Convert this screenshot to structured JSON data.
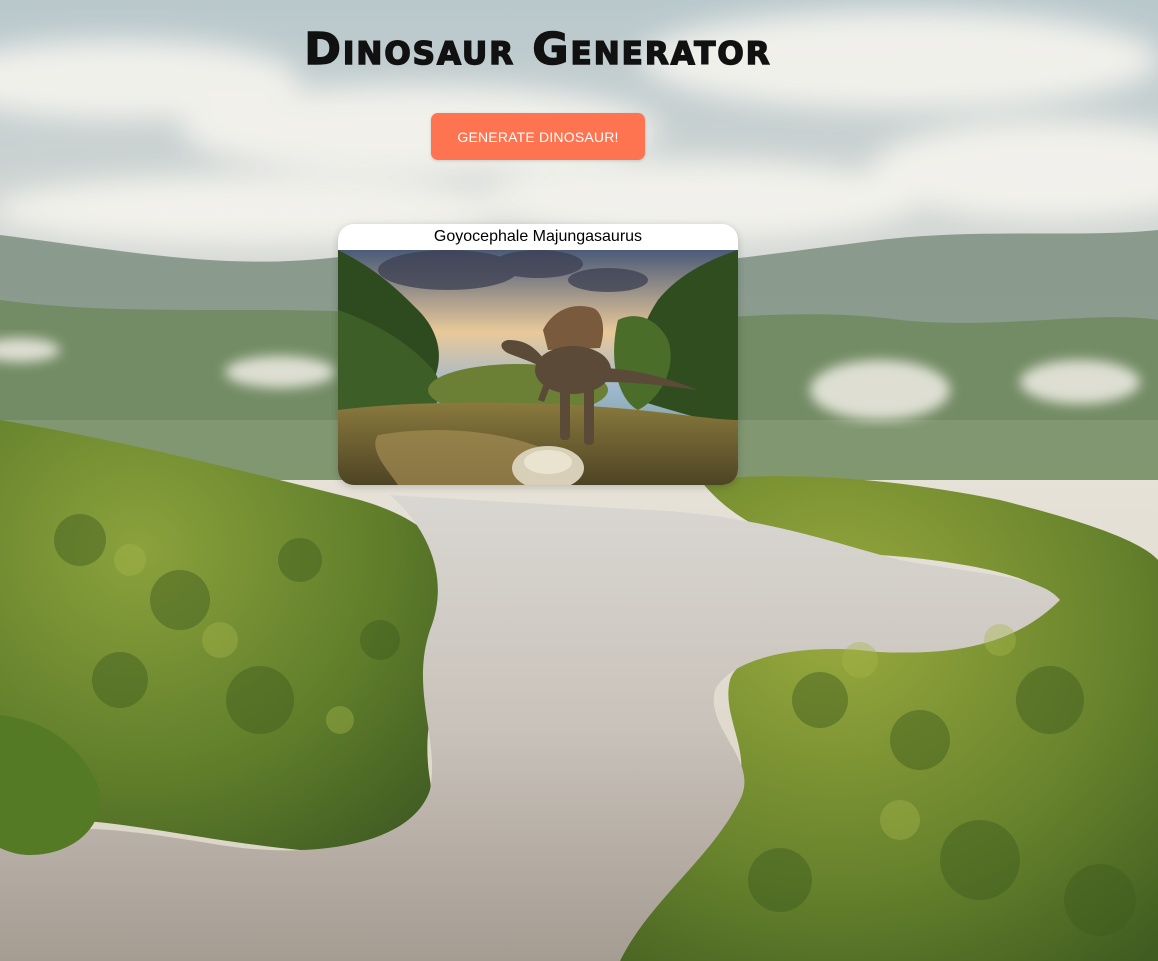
{
  "app": {
    "title": "Dinosaur Generator"
  },
  "controls": {
    "generate_label": "GENERATE DINOSAUR!",
    "button_color": "#ff7450"
  },
  "dinosaur": {
    "name": "Goyocephale Majungasaurus",
    "image_icon": "spinosaurus-in-forest-photo"
  },
  "background": {
    "scene": "jungle-river-aerial-photo"
  }
}
